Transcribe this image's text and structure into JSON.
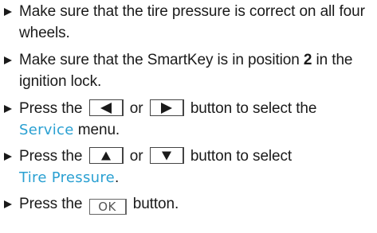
{
  "steps": [
    {
      "text": "Make sure that the tire pressure is correct on all four wheels."
    },
    {
      "text_before": "Make sure that the SmartKey is in position ",
      "bold": "2",
      "text_after": " in the ignition lock."
    },
    {
      "press": "Press the",
      "or": "or",
      "text_after": "button to select the",
      "menu": "Service",
      "menu_suffix": " menu.",
      "buttons": [
        "left-arrow-icon",
        "right-arrow-icon"
      ]
    },
    {
      "press": "Press the",
      "or": "or",
      "text_after": "button to select",
      "menu": "Tire Pressure",
      "menu_suffix": ".",
      "buttons": [
        "up-arrow-icon",
        "down-arrow-icon"
      ]
    },
    {
      "press": "Press the",
      "button_label": "OK",
      "text_after": "button."
    }
  ],
  "colors": {
    "text": "#1a1a1a",
    "display_text": "#2aa0d2"
  }
}
